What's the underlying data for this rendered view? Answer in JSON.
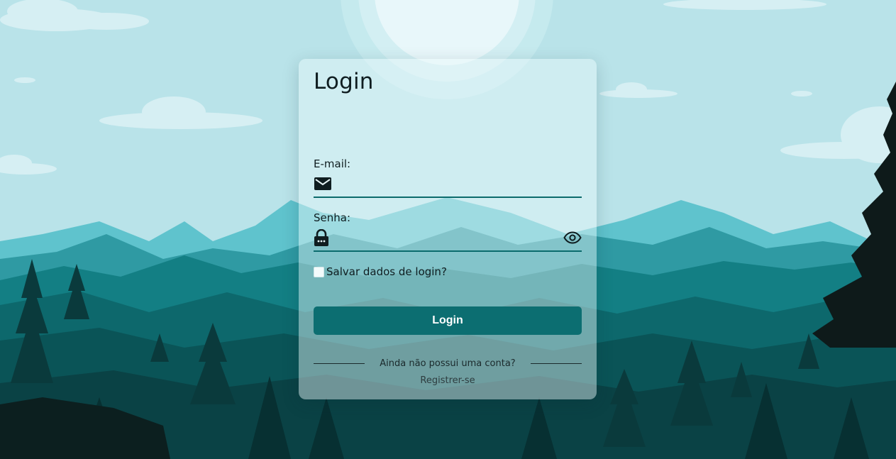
{
  "login_form": {
    "title": "Login",
    "email": {
      "label": "E-mail:",
      "value": "",
      "placeholder": "",
      "icon": "envelope-icon"
    },
    "password": {
      "label": "Senha:",
      "value": "",
      "placeholder": "",
      "icon": "lock-icon",
      "toggle_icon": "eye-icon"
    },
    "remember": {
      "label": "Salvar dados de login?",
      "checked": false
    },
    "submit_label": "Login",
    "no_account_text": "Ainda não possui uma conta?",
    "register_label": "Registrer-se"
  },
  "colors": {
    "accent": "#0c6e71",
    "sky": "#b9e3e9",
    "text": "#0f1d20"
  }
}
